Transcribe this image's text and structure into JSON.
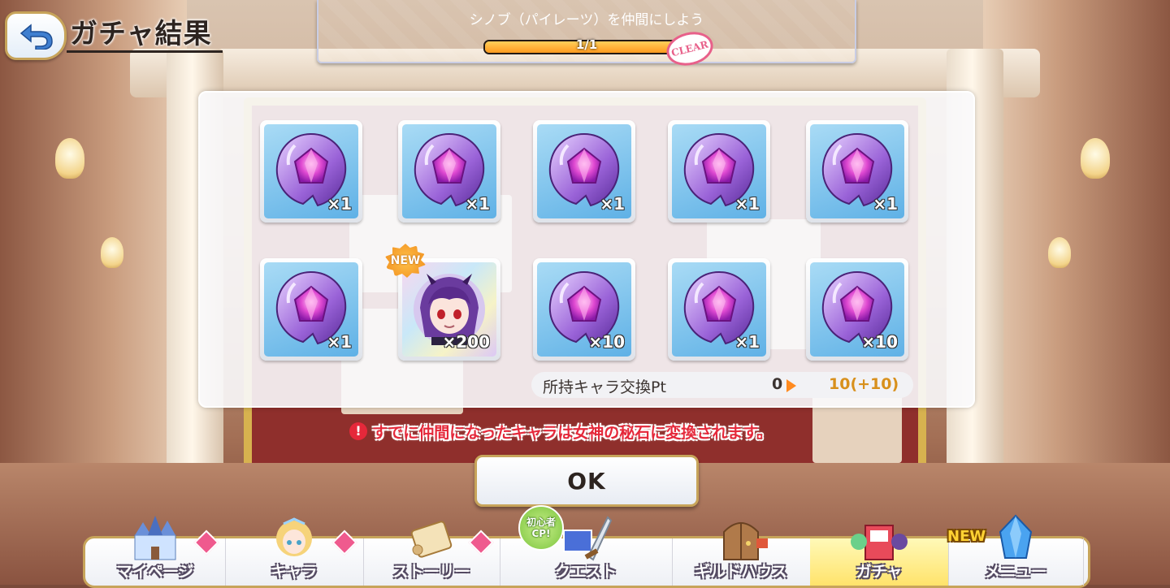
{
  "header": {
    "back_label": "back",
    "title": "ガチャ結果"
  },
  "mission": {
    "text": "シノブ（パイレーツ）を仲間にしよう",
    "progress_text": "1/1",
    "progress": 1.0,
    "clear_label": "CLEAR"
  },
  "results": {
    "items": [
      {
        "type": "stone",
        "qty": "×1"
      },
      {
        "type": "stone",
        "qty": "×1"
      },
      {
        "type": "stone",
        "qty": "×1"
      },
      {
        "type": "stone",
        "qty": "×1"
      },
      {
        "type": "stone",
        "qty": "×1"
      },
      {
        "type": "stone",
        "qty": "×1"
      },
      {
        "type": "character",
        "qty": "×200",
        "badge": "NEW"
      },
      {
        "type": "stone",
        "qty": "×10"
      },
      {
        "type": "stone",
        "qty": "×1"
      },
      {
        "type": "stone",
        "qty": "×10"
      }
    ]
  },
  "exchange": {
    "label": "所持キャラ交換Pt",
    "from": "0",
    "to": "10(+10)"
  },
  "notice": {
    "text": "すでに仲間になったキャラは女神の秘石に変換されます。",
    "icon": "!"
  },
  "ok_button": {
    "label": "OK"
  },
  "nav": {
    "items": [
      {
        "label": "マイページ",
        "icon": "castle-icon",
        "active": false
      },
      {
        "label": "キャラ",
        "icon": "character-icon",
        "active": false
      },
      {
        "label": "ストーリー",
        "icon": "scroll-icon",
        "active": false
      },
      {
        "label": "クエスト",
        "icon": "sword-icon",
        "active": false
      },
      {
        "label": "ギルドハウス",
        "icon": "door-icon",
        "active": false
      },
      {
        "label": "ガチャ",
        "icon": "gacha-icon",
        "active": true
      },
      {
        "label": "メニュー",
        "icon": "crystal-icon",
        "active": false
      }
    ],
    "new_tag": "NEW",
    "beginner_tag_line1": "初心者",
    "beginner_tag_line2": "CP!"
  },
  "colors": {
    "accent_gold": "#c7a45a",
    "notice_red": "#e5283a",
    "exchange_to": "#d8901c",
    "active_tab": "#ffe36b"
  }
}
